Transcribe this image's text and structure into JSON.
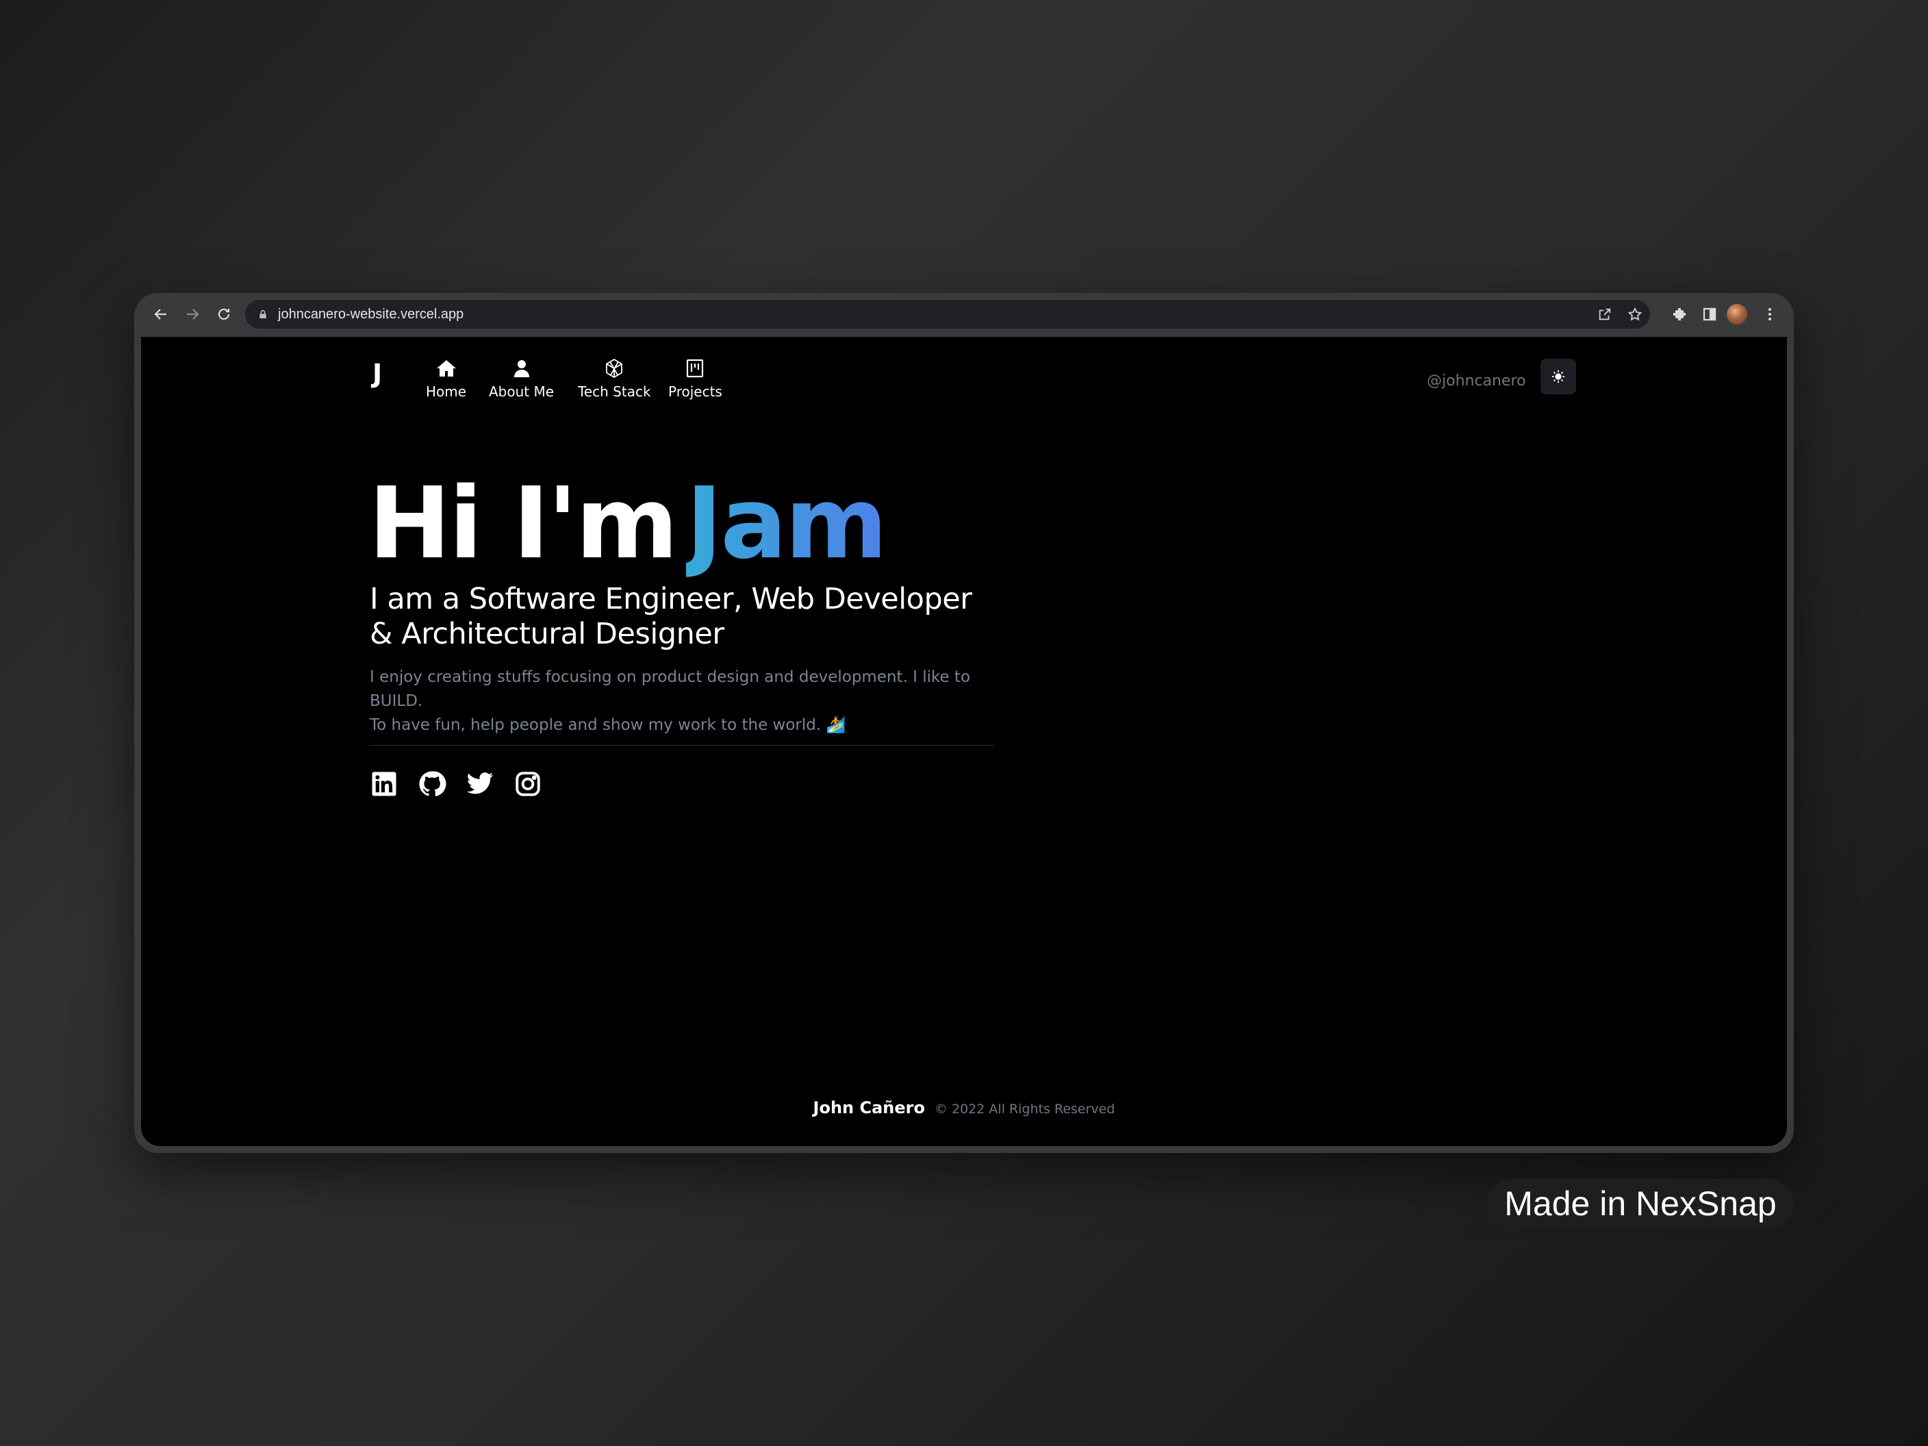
{
  "browser": {
    "url": "johncanero-website.vercel.app",
    "icons": [
      "back-icon",
      "forward-icon",
      "reload-icon",
      "lock-icon",
      "share-icon",
      "star-icon",
      "extensions-icon",
      "side-panel-icon",
      "profile-avatar",
      "more-icon"
    ]
  },
  "nav": {
    "logo": "J",
    "items": [
      {
        "label": "Home",
        "icon": "home-icon"
      },
      {
        "label": "About Me",
        "icon": "user-icon"
      },
      {
        "label": "Tech Stack",
        "icon": "hexagon-icon"
      },
      {
        "label": "Projects",
        "icon": "kanban-icon"
      }
    ],
    "handle": "@johncanero",
    "theme_icon": "sun-icon"
  },
  "hero": {
    "greeting": "Hi I'm",
    "name": "Jam",
    "subtitle_line1": "I am a Software Engineer, Web Developer",
    "subtitle_line2": "& Architectural Designer",
    "desc_line1": "I enjoy creating stuffs focusing on product design and development. I like to BUILD.",
    "desc_line2": "To have fun, help people and show my work to the world. 🏄",
    "name_gradient": [
      "#38a8d8",
      "#4f82e8"
    ]
  },
  "social": [
    "linkedin-icon",
    "github-icon",
    "twitter-icon",
    "instagram-icon"
  ],
  "footer": {
    "name": "John Cañero",
    "copyright": "© 2022 All Rights Reserved"
  },
  "watermark": "Made in NexSnap"
}
